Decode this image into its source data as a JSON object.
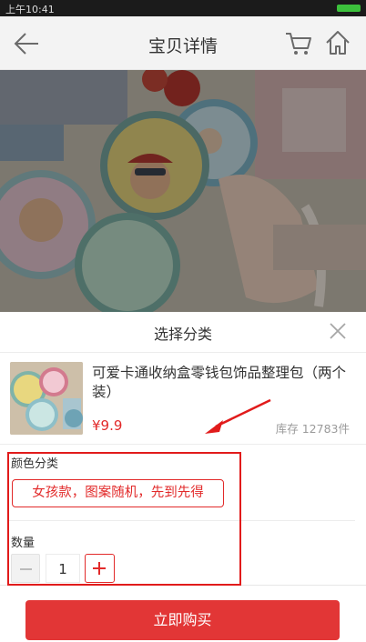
{
  "status_bar": {
    "time": "上午10:41"
  },
  "header": {
    "title": "宝贝详情",
    "back_icon": "arrow-left-icon",
    "cart_icon": "cart-icon",
    "home_icon": "home-icon"
  },
  "sheet": {
    "title": "选择分类",
    "close_icon": "close-icon",
    "product": {
      "name": "可爱卡通收纳盒零钱包饰品整理包（两个装）",
      "price": "¥9.9",
      "stock": "库存 12783件"
    },
    "color_label": "颜色分类",
    "color_option": "女孩款，图案随机，先到先得",
    "quantity_label": "数量",
    "quantity_value": "1",
    "buy_label": "立即购买"
  },
  "colors": {
    "accent": "#e22a2a",
    "buy_button": "#e23636"
  }
}
